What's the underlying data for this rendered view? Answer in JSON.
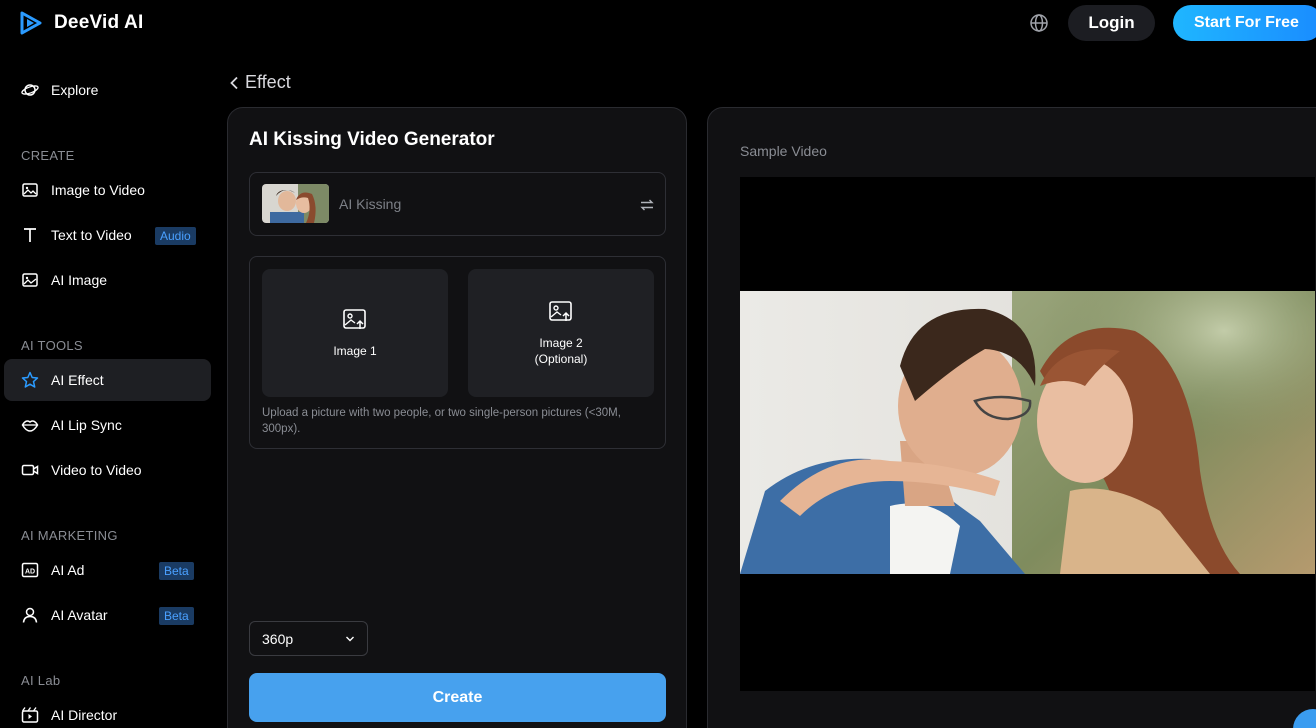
{
  "header": {
    "brand": "DeeVid AI",
    "login_label": "Login",
    "start_label": "Start For Free",
    "accent_color": "#1a9dff"
  },
  "sidebar": {
    "explore": "Explore",
    "sections": {
      "create": "CREATE",
      "ai_tools": "AI TOOLS",
      "ai_marketing": "AI MARKETING",
      "ai_lab": "AI Lab"
    },
    "items": {
      "image_to_video": "Image to Video",
      "text_to_video": "Text to Video",
      "text_to_video_badge": "Audio",
      "ai_image": "AI Image",
      "ai_effect": "AI Effect",
      "ai_lip_sync": "AI Lip Sync",
      "video_to_video": "Video to Video",
      "ai_ad": "AI Ad",
      "ai_ad_badge": "Beta",
      "ai_avatar": "AI Avatar",
      "ai_avatar_badge": "Beta",
      "ai_director": "AI Director"
    },
    "active_item": "ai_effect"
  },
  "main": {
    "back_label": "Effect",
    "title": "AI Kissing Video Generator",
    "effect_name": "AI Kissing",
    "upload": {
      "image1_label": "Image 1",
      "image2_label_line1": "Image 2",
      "image2_label_line2": "(Optional)",
      "hint": "Upload a picture with two people, or two single-person pictures (<30M, 300px)."
    },
    "resolution": "360p",
    "create_label": "Create"
  },
  "preview": {
    "label": "Sample Video"
  }
}
